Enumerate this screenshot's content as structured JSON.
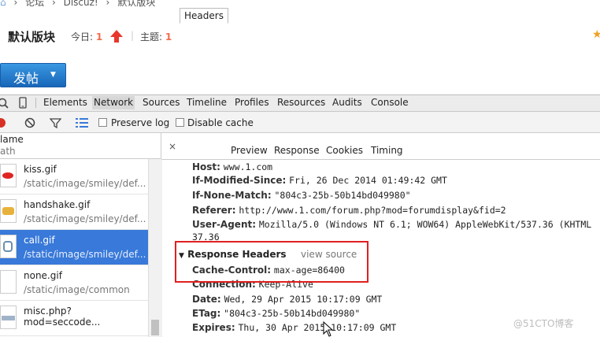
{
  "breadcrumb": {
    "items": [
      "论坛",
      "Discuz!",
      "默认版块"
    ],
    "separator": "›"
  },
  "forum": {
    "title": "默认版块",
    "today_label": "今日:",
    "today_count": "1",
    "topics_label": "主题:",
    "topics_count": "1",
    "post_button": "发帖"
  },
  "devtools": {
    "tabs": [
      "Elements",
      "Network",
      "Sources",
      "Timeline",
      "Profiles",
      "Resources",
      "Audits",
      "Console"
    ],
    "active_tab": "Network",
    "toolbar": {
      "preserve_log": "Preserve log",
      "disable_cache": "Disable cache"
    },
    "list_header": {
      "name": "lame",
      "path": "ath"
    },
    "requests": [
      {
        "name": "kiss.gif",
        "path": "/static/image/smiley/def...",
        "selected": false
      },
      {
        "name": "handshake.gif",
        "path": "/static/image/smiley/def...",
        "selected": false
      },
      {
        "name": "call.gif",
        "path": "/static/image/smiley/def...",
        "selected": true
      },
      {
        "name": "none.gif",
        "path": "/static/image/common",
        "selected": false
      },
      {
        "name": "misc.php?mod=seccode...",
        "path": "",
        "selected": false
      }
    ],
    "close_label": "×",
    "detail_tabs": [
      "Headers",
      "Preview",
      "Response",
      "Cookies",
      "Timing"
    ],
    "request_headers": [
      {
        "key": "Host:",
        "value": "www.1.com"
      },
      {
        "key": "If-Modified-Since:",
        "value": "Fri, 26 Dec 2014 01:49:42 GMT"
      },
      {
        "key": "If-None-Match:",
        "value": "\"804c3-25b-50b14bd049980\""
      },
      {
        "key": "Referer:",
        "value": "http://www.1.com/forum.php?mod=forumdisplay&fid=2"
      },
      {
        "key": "User-Agent:",
        "value": "Mozilla/5.0 (Windows NT 6.1; WOW64) AppleWebKit/537.36 (KHTML"
      },
      {
        "key": "",
        "value": "37.36"
      }
    ],
    "response_section": {
      "title": "Response Headers",
      "view_source": "view source"
    },
    "response_headers": [
      {
        "key": "Cache-Control:",
        "value": "max-age=86400"
      },
      {
        "key": "Connection:",
        "value": "Keep-Alive"
      },
      {
        "key": "Date:",
        "value": "Wed, 29 Apr 2015 10:17:09 GMT"
      },
      {
        "key": "ETag:",
        "value": "\"804c3-25b-50b14bd049980\""
      },
      {
        "key": "Expires:",
        "value": "Thu, 30 Apr 2015 10:17:09 GMT"
      }
    ]
  },
  "watermark": "@51CTO博客",
  "colors": {
    "accent": "#f26c4f",
    "selected_row": "#3879d9",
    "highlight_box": "#e02020",
    "post_button": "#1e76c8"
  }
}
